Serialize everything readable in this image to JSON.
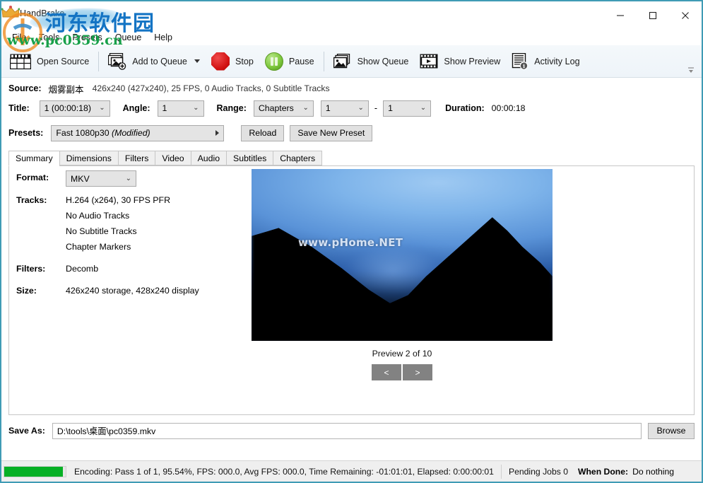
{
  "window": {
    "title": "HandBrake",
    "minimize_label": "Minimize",
    "maximize_label": "Maximize",
    "close_label": "Close",
    "border_color": "#3f9bb5"
  },
  "menubar": {
    "items": [
      {
        "label": "File"
      },
      {
        "label": "Tools"
      },
      {
        "label": "Presets"
      },
      {
        "label": "Queue"
      },
      {
        "label": "Help"
      }
    ]
  },
  "toolbar": {
    "open_source": "Open Source",
    "add_to_queue": "Add to Queue",
    "stop": "Stop",
    "pause": "Pause",
    "show_queue": "Show Queue",
    "show_preview": "Show Preview",
    "activity_log": "Activity Log",
    "overflow": "⌄"
  },
  "source": {
    "label": "Source:",
    "name": "烟雾副本",
    "meta": "426x240 (427x240), 25 FPS, 0 Audio Tracks, 0 Subtitle Tracks"
  },
  "title_row": {
    "title_label": "Title:",
    "title_value": "1 (00:00:18)",
    "angle_label": "Angle:",
    "angle_value": "1",
    "range_label": "Range:",
    "range_value": "Chapters",
    "chapter_start": "1",
    "dash": "-",
    "chapter_end": "1",
    "duration_label": "Duration:",
    "duration_value": "00:00:18"
  },
  "presets": {
    "label": "Presets:",
    "value": "Fast 1080p30",
    "value_modifier": "(Modified)",
    "reload": "Reload",
    "save_new_preset": "Save New Preset"
  },
  "tabs": [
    {
      "label": "Summary",
      "active": true
    },
    {
      "label": "Dimensions",
      "active": false
    },
    {
      "label": "Filters",
      "active": false
    },
    {
      "label": "Video",
      "active": false
    },
    {
      "label": "Audio",
      "active": false
    },
    {
      "label": "Subtitles",
      "active": false
    },
    {
      "label": "Chapters",
      "active": false
    }
  ],
  "summary": {
    "format_label": "Format:",
    "format_value": "MKV",
    "tracks_label": "Tracks:",
    "tracks": [
      "H.264 (x264), 30 FPS PFR",
      "No Audio Tracks",
      "No Subtitle Tracks",
      "Chapter Markers"
    ],
    "filters_label": "Filters:",
    "filters_value": "Decomb",
    "size_label": "Size:",
    "size_value": "426x240 storage, 428x240 display"
  },
  "preview": {
    "watermark": "www.pHome.NET",
    "caption": "Preview 2 of 10",
    "prev": "<",
    "next": ">"
  },
  "save_as": {
    "label": "Save As:",
    "value": "D:\\tools\\桌面\\pc0359.mkv",
    "browse": "Browse"
  },
  "status": {
    "progress_percent": 95.54,
    "text": "Encoding: Pass 1 of 1,  95.54%, FPS: 000.0,  Avg FPS: 000.0,  Time Remaining: -01:01:01,  Elapsed: 0:00:00:01",
    "pending_jobs": "Pending Jobs 0",
    "when_done_label": "When Done:",
    "when_done_value": "Do nothing",
    "progress_color": "#06b025"
  },
  "watermark": {
    "chinese": "河东软件园",
    "url": "www.pc0359.cn",
    "chinese_color": "#1474c4",
    "url_color": "#18a04a"
  }
}
